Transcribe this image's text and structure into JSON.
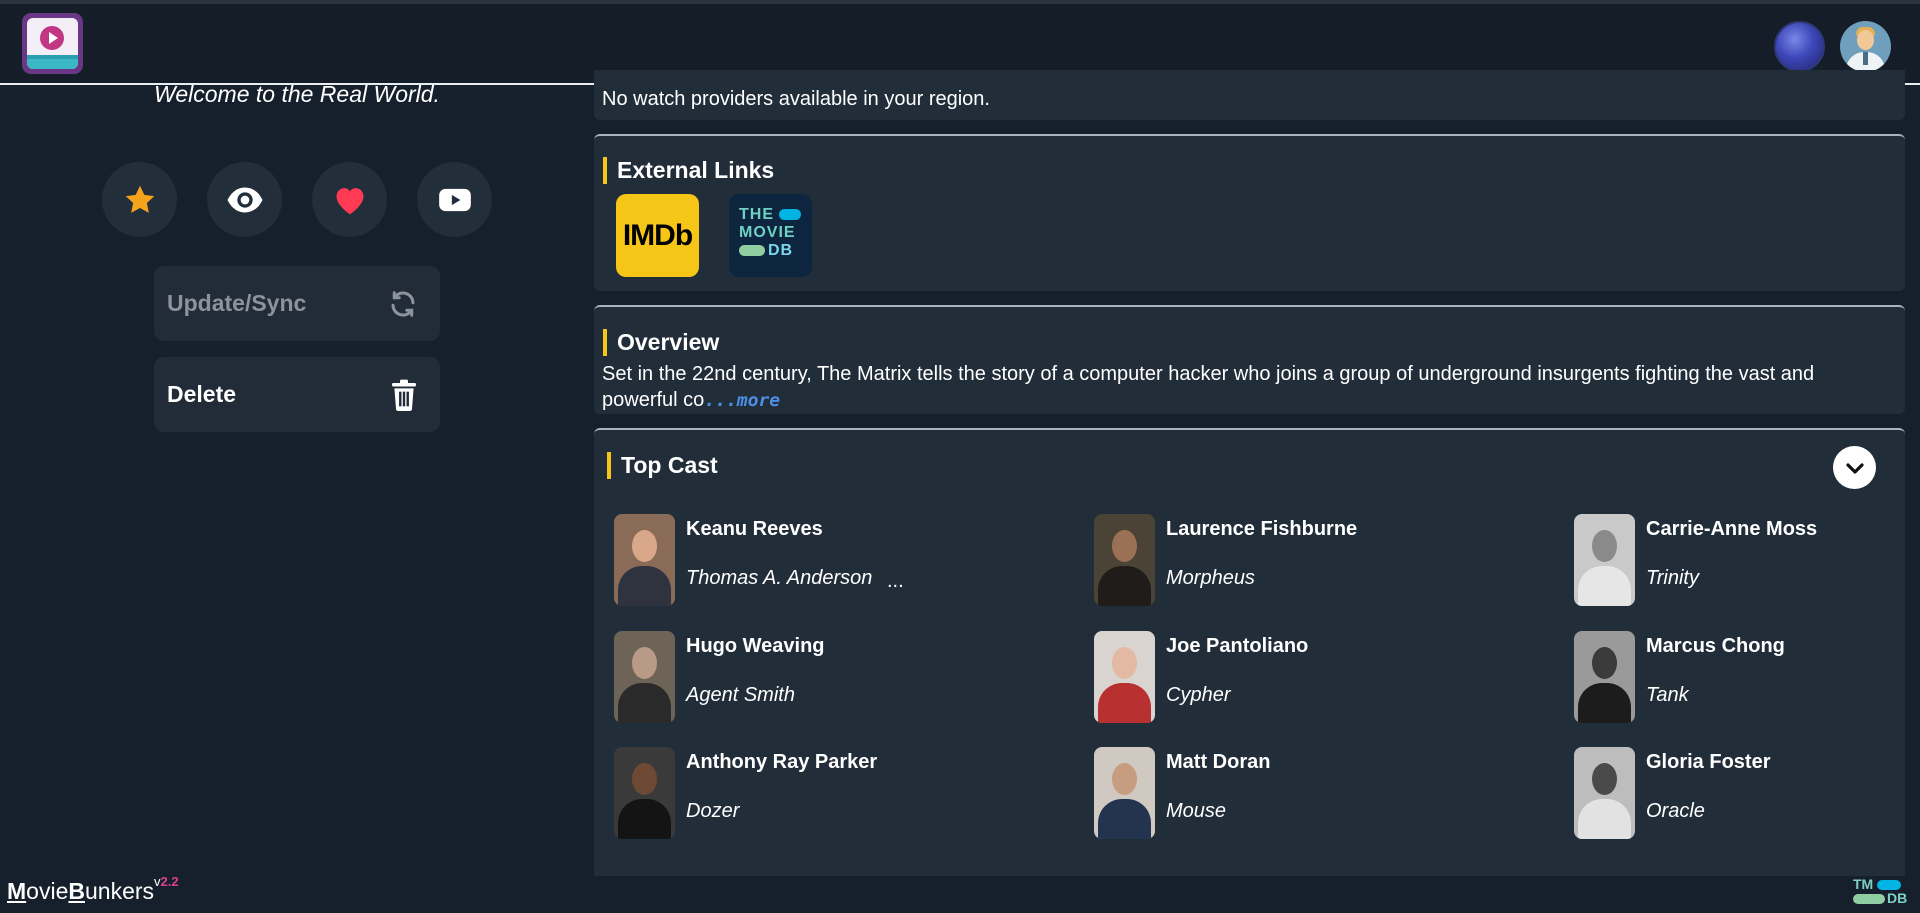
{
  "header": {
    "app_logo": "moviebunkers-logo",
    "icons": [
      "space-avatar",
      "user-avatar"
    ]
  },
  "movie": {
    "tagline": "Welcome to the Real World."
  },
  "actions": {
    "icons": [
      "star-icon",
      "eye-icon",
      "heart-icon",
      "youtube-icon"
    ],
    "update_label": "Update/Sync",
    "delete_label": "Delete"
  },
  "providers": {
    "text": "No watch providers available in your region."
  },
  "external_links": {
    "title": "External Links",
    "imdb_label": "IMDb",
    "tmdb_line1": "THE",
    "tmdb_line2": "MOVIE",
    "tmdb_line3": "DB"
  },
  "overview": {
    "title": "Overview",
    "text": "Set in the 22nd century, The Matrix tells the story of a computer hacker who joins a group of underground insurgents fighting the vast and powerful co",
    "more": "...more"
  },
  "cast": {
    "title": "Top Cast",
    "members": [
      {
        "name": "Keanu Reeves",
        "role": "Thomas A. Anderson"
      },
      {
        "name": "Laurence Fishburne",
        "role": "Morpheus"
      },
      {
        "name": "Carrie-Anne Moss",
        "role": "Trinity"
      },
      {
        "name": "Hugo Weaving",
        "role": "Agent Smith"
      },
      {
        "name": "Joe Pantoliano",
        "role": "Cypher"
      },
      {
        "name": "Marcus Chong",
        "role": "Tank"
      },
      {
        "name": "Anthony Ray Parker",
        "role": "Dozer"
      },
      {
        "name": "Matt Doran",
        "role": "Mouse"
      },
      {
        "name": "Gloria Foster",
        "role": "Oracle"
      }
    ],
    "overflow_marker": "..."
  },
  "footer": {
    "brand_m": "M",
    "brand_ovie": "ovie",
    "brand_b": "B",
    "brand_unkers": "unkers",
    "version_prefix": "v",
    "version": "2.2",
    "tmdb_line1": "TM",
    "tmdb_line2": "DB"
  },
  "colors": {
    "accent_bar": "#f5c518",
    "star": "#f5a31a",
    "heart": "#ff3a52",
    "link_more": "#4e8fe6",
    "version": "#d9418f"
  }
}
